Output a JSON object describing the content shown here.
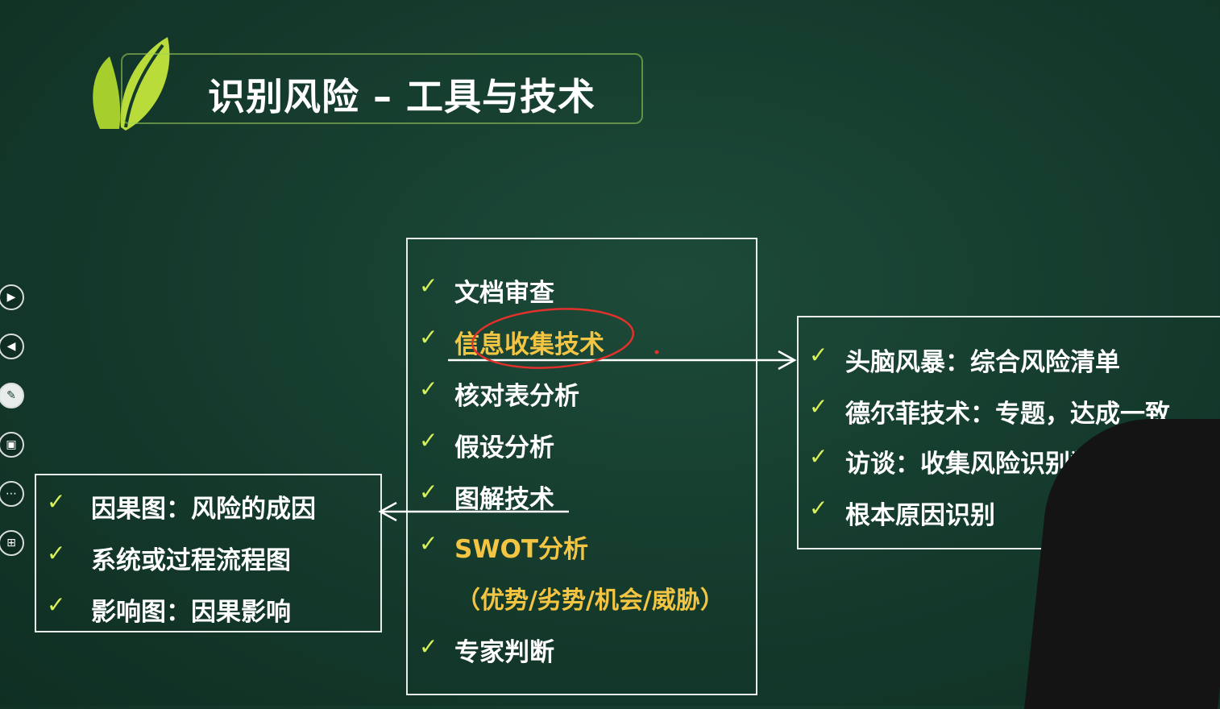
{
  "slide": {
    "title": "识别风险 – 工具与技术"
  },
  "center_list": [
    {
      "text": "文档审查",
      "highlight": false
    },
    {
      "text": "信息收集技术",
      "highlight": true
    },
    {
      "text": "核对表分析",
      "highlight": false
    },
    {
      "text": "假设分析",
      "highlight": false
    },
    {
      "text": "图解技术",
      "highlight": false
    },
    {
      "text": "SWOT分析",
      "highlight": true
    },
    {
      "text": "（优势/劣势/机会/威胁）",
      "highlight": true
    },
    {
      "text": "专家判断",
      "highlight": false
    }
  ],
  "right_list": [
    "头脑风暴：综合风险清单",
    "德尔菲技术：专题，达成一致",
    "访谈：收集风险识别数据",
    "根本原因识别"
  ],
  "left_list": [
    "因果图：风险的成因",
    "系统或过程流程图",
    "影响图：因果影响"
  ],
  "check_mark": "✓",
  "sidebar": [
    {
      "name": "play-icon",
      "glyph": "▶"
    },
    {
      "name": "back-icon",
      "glyph": "◀"
    },
    {
      "name": "pen-icon",
      "glyph": "✎"
    },
    {
      "name": "screen-icon",
      "glyph": "▣"
    },
    {
      "name": "more-icon",
      "glyph": "⋯"
    },
    {
      "name": "grid-icon",
      "glyph": "⊞"
    }
  ],
  "colors": {
    "background": "#143a2c",
    "highlight_text": "#f4c542",
    "check": "#d9f25a",
    "annotation_ink": "#e0322a"
  }
}
